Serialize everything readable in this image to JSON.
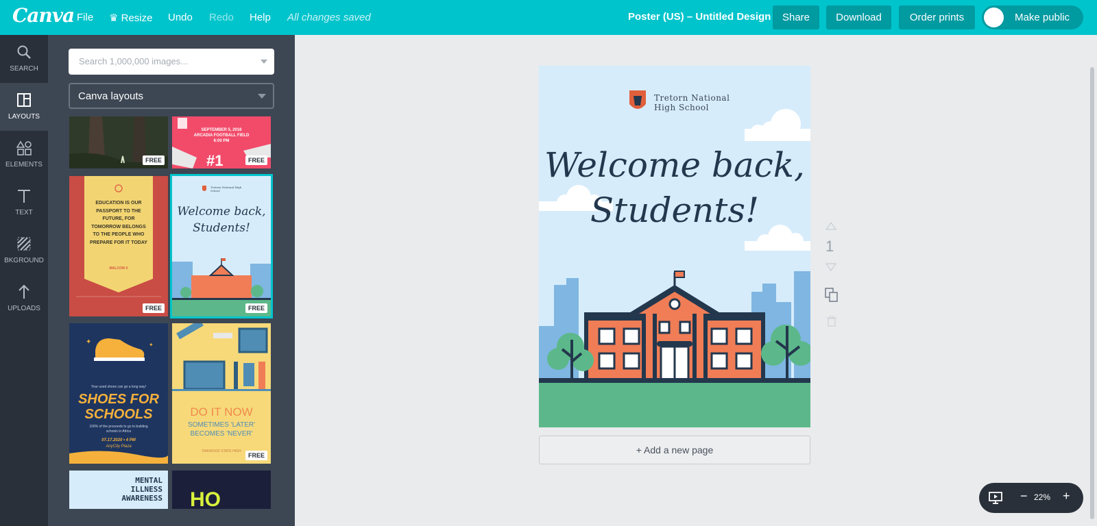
{
  "app": {
    "logo": "Canva",
    "menu": {
      "file": "File",
      "resize": "Resize",
      "undo": "Undo",
      "redo": "Redo",
      "help": "Help",
      "status": "All changes saved"
    },
    "doc_title": "Poster (US) – Untitled Design",
    "buttons": {
      "share": "Share",
      "download": "Download",
      "order_prints": "Order prints",
      "make_public": "Make public"
    }
  },
  "leftnav": {
    "items": [
      {
        "label": "SEARCH",
        "icon": "search-icon"
      },
      {
        "label": "LAYOUTS",
        "icon": "layouts-icon"
      },
      {
        "label": "ELEMENTS",
        "icon": "elements-icon"
      },
      {
        "label": "TEXT",
        "icon": "text-icon"
      },
      {
        "label": "BKGROUND",
        "icon": "background-icon"
      },
      {
        "label": "UPLOADS",
        "icon": "upload-icon"
      }
    ],
    "active_index": 1
  },
  "panel": {
    "search_placeholder": "Search 1,000,000 images...",
    "select_value": "Canva layouts",
    "free_badge": "FREE",
    "thumbs": {
      "football": {
        "line1": "SEPTEMBER 5, 2016",
        "line2": "ARCADIA FOOTBALL FIELD",
        "line3": "6:00 PM"
      },
      "quote": {
        "text": "EDUCATION IS OUR PASSPORT TO THE FUTURE, FOR TOMORROW BELONGS TO THE PEOPLE WHO PREPARE FOR IT TODAY",
        "author": "MALCOM X"
      },
      "welcome": {
        "school": "Tretorn National High School",
        "headline_1": "Welcome back,",
        "headline_2": "Students!"
      },
      "shoes": {
        "tag": "Your used shoes can go a long way!",
        "title_1": "SHOES FOR",
        "title_2": "SCHOOLS",
        "body": "100% of the proceeds to go to building schools in Africa",
        "date": "07.17.2020 • 4 PM",
        "place": "AnyCity Plaza"
      },
      "doit": {
        "title": "DO IT NOW",
        "sub_1": "SOMETIMES 'LATER'",
        "sub_2": "BECOMES 'NEVER'",
        "footer": "OAKWOOD STATE HIGH"
      },
      "mental": {
        "line1": "MENTAL",
        "line2": "ILLNESS",
        "line3": "AWARENESS"
      },
      "ho": {
        "text": "HO"
      }
    }
  },
  "poster": {
    "school_line1": "Tretorn National",
    "school_line2": "High School",
    "headline_1": "Welcome back,",
    "headline_2": "Students!",
    "colors": {
      "sky": "#d6ecfb",
      "ground": "#5cb88a",
      "building": "#f07d56",
      "navy": "#23374d"
    }
  },
  "canvas": {
    "add_page": "+ Add a new page",
    "page_number": "1",
    "zoom": "22%"
  }
}
